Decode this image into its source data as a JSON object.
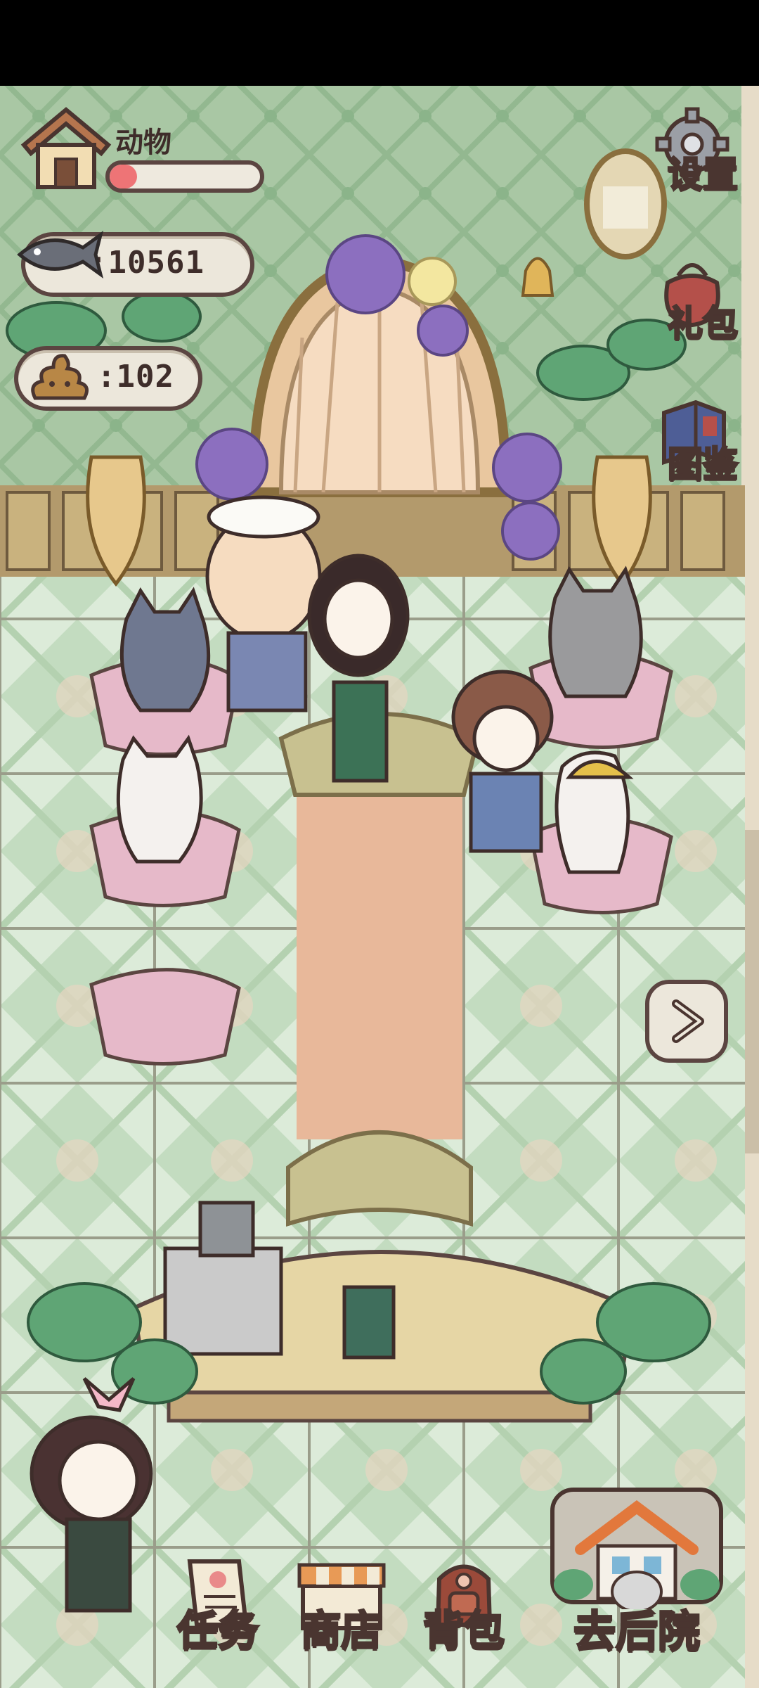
{
  "hud": {
    "animal_label": "动物",
    "animal_progress": 0.18,
    "fish_count": ":10561",
    "poop_count": ":102"
  },
  "side_menu": {
    "settings": "设置",
    "gift": "礼包",
    "catalog": "图鉴"
  },
  "bottom_menu": {
    "tasks": "任务",
    "shop": "商店",
    "backpack": "背包",
    "backyard": "去后院"
  },
  "colors": {
    "wall": "#a9c7a4",
    "floor": "#d8e8d6",
    "outline": "#5b4541",
    "panel": "#ece7db",
    "progress": "#ee7476"
  }
}
